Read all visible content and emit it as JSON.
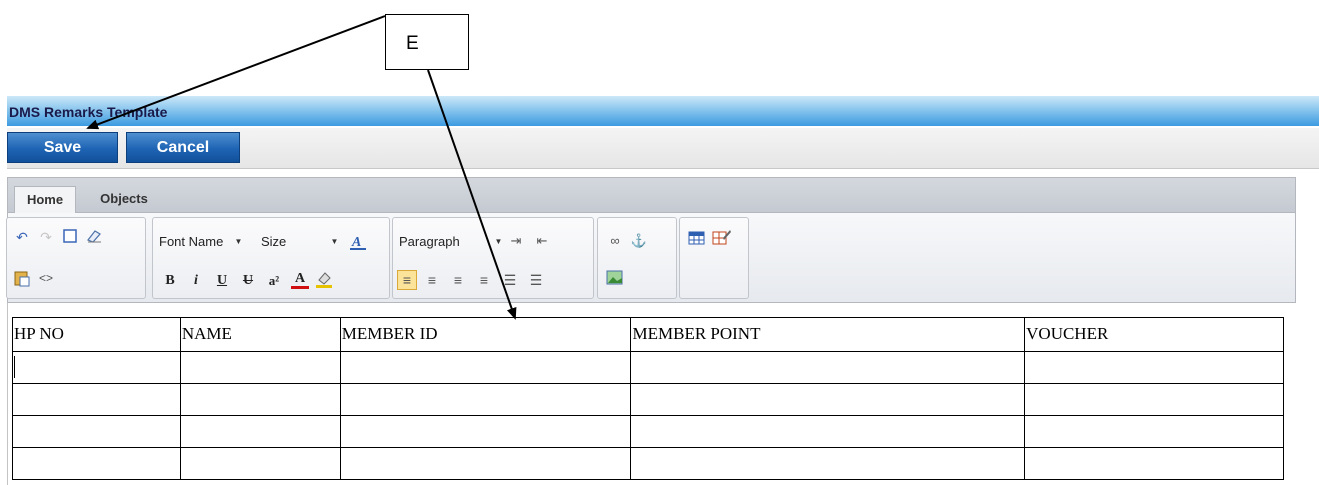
{
  "callout": {
    "label": "E"
  },
  "window": {
    "title": "DMS Remarks Template"
  },
  "buttons": {
    "save": "Save",
    "cancel": "Cancel"
  },
  "tabs": [
    {
      "label": "Home",
      "active": true
    },
    {
      "label": "Objects",
      "active": false
    }
  ],
  "ribbon": {
    "font_name": "Font Name",
    "font_size": "Size",
    "paragraph": "Paragraph",
    "format_buttons": {
      "bold": "B",
      "italic": "i",
      "underline": "U",
      "strike": "U",
      "superscript": "a²",
      "font_color": "A"
    }
  },
  "table": {
    "headers": [
      "HP NO",
      "NAME",
      "MEMBER ID",
      "MEMBER POINT",
      "VOUCHER"
    ],
    "rows": [
      [
        "",
        "",
        "",
        "",
        ""
      ],
      [
        "",
        "",
        "",
        "",
        ""
      ],
      [
        "",
        "",
        "",
        "",
        ""
      ],
      [
        "",
        "",
        "",
        "",
        ""
      ]
    ]
  }
}
